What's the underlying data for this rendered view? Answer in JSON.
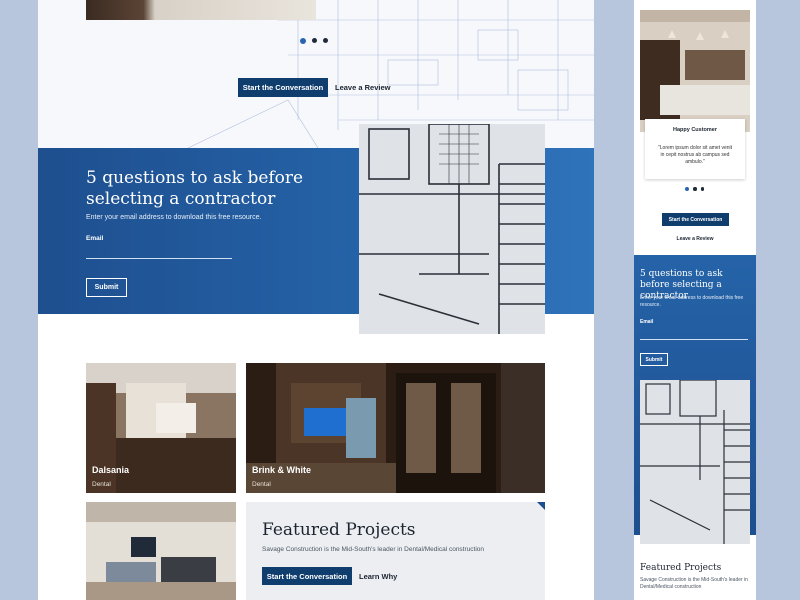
{
  "colors": {
    "primary": "#0f3d6e",
    "band": "#2563a8",
    "background": "#b7c6dc"
  },
  "desktop": {
    "hero": {
      "cta_primary": "Start the Conversation",
      "cta_secondary": "Leave a Review"
    },
    "download": {
      "title": "5 questions to ask before selecting a contractor",
      "subtitle": "Enter your email address to download this free resource.",
      "email_label": "Email",
      "email_value": "",
      "submit_label": "Submit"
    },
    "projects": [
      {
        "name": "Dalsania",
        "category": "Dental"
      },
      {
        "name": "Brink & White",
        "category": "Dental"
      }
    ],
    "featured": {
      "title": "Featured Projects",
      "subtitle": "Savage Construction is the Mid-South's leader in Dental/Medical construction",
      "cta_primary": "Start the Conversation",
      "cta_secondary": "Learn Why"
    }
  },
  "mobile": {
    "testimonial": {
      "title": "Happy Customer",
      "quote": "\"Lorem ipsum dolor sit amet venit in cepit nostrus ab campus sed ambulo.\""
    },
    "cta_primary": "Start the Conversation",
    "cta_secondary": "Leave a Review",
    "download": {
      "title": "5 questions to ask before selecting a contractor",
      "subtitle": "Enter your email address to download this free resource.",
      "email_label": "Email",
      "submit_label": "Submit"
    },
    "featured": {
      "title": "Featured Projects",
      "subtitle": "Savage Construction is the Mid-South's leader in Dental/Medical construction"
    }
  }
}
